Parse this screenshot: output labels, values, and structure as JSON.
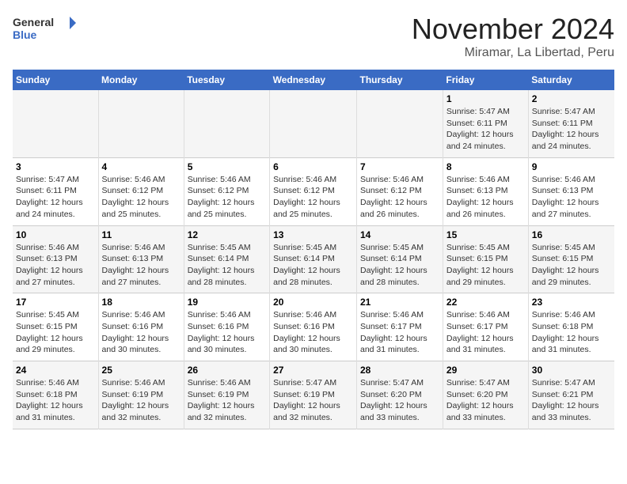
{
  "logo": {
    "line1": "General",
    "line2": "Blue"
  },
  "title": "November 2024",
  "subtitle": "Miramar, La Libertad, Peru",
  "days_header": [
    "Sunday",
    "Monday",
    "Tuesday",
    "Wednesday",
    "Thursday",
    "Friday",
    "Saturday"
  ],
  "weeks": [
    [
      {
        "day": "",
        "info": ""
      },
      {
        "day": "",
        "info": ""
      },
      {
        "day": "",
        "info": ""
      },
      {
        "day": "",
        "info": ""
      },
      {
        "day": "",
        "info": ""
      },
      {
        "day": "1",
        "info": "Sunrise: 5:47 AM\nSunset: 6:11 PM\nDaylight: 12 hours and 24 minutes."
      },
      {
        "day": "2",
        "info": "Sunrise: 5:47 AM\nSunset: 6:11 PM\nDaylight: 12 hours and 24 minutes."
      }
    ],
    [
      {
        "day": "3",
        "info": "Sunrise: 5:47 AM\nSunset: 6:11 PM\nDaylight: 12 hours and 24 minutes."
      },
      {
        "day": "4",
        "info": "Sunrise: 5:46 AM\nSunset: 6:12 PM\nDaylight: 12 hours and 25 minutes."
      },
      {
        "day": "5",
        "info": "Sunrise: 5:46 AM\nSunset: 6:12 PM\nDaylight: 12 hours and 25 minutes."
      },
      {
        "day": "6",
        "info": "Sunrise: 5:46 AM\nSunset: 6:12 PM\nDaylight: 12 hours and 25 minutes."
      },
      {
        "day": "7",
        "info": "Sunrise: 5:46 AM\nSunset: 6:12 PM\nDaylight: 12 hours and 26 minutes."
      },
      {
        "day": "8",
        "info": "Sunrise: 5:46 AM\nSunset: 6:13 PM\nDaylight: 12 hours and 26 minutes."
      },
      {
        "day": "9",
        "info": "Sunrise: 5:46 AM\nSunset: 6:13 PM\nDaylight: 12 hours and 27 minutes."
      }
    ],
    [
      {
        "day": "10",
        "info": "Sunrise: 5:46 AM\nSunset: 6:13 PM\nDaylight: 12 hours and 27 minutes."
      },
      {
        "day": "11",
        "info": "Sunrise: 5:46 AM\nSunset: 6:13 PM\nDaylight: 12 hours and 27 minutes."
      },
      {
        "day": "12",
        "info": "Sunrise: 5:45 AM\nSunset: 6:14 PM\nDaylight: 12 hours and 28 minutes."
      },
      {
        "day": "13",
        "info": "Sunrise: 5:45 AM\nSunset: 6:14 PM\nDaylight: 12 hours and 28 minutes."
      },
      {
        "day": "14",
        "info": "Sunrise: 5:45 AM\nSunset: 6:14 PM\nDaylight: 12 hours and 28 minutes."
      },
      {
        "day": "15",
        "info": "Sunrise: 5:45 AM\nSunset: 6:15 PM\nDaylight: 12 hours and 29 minutes."
      },
      {
        "day": "16",
        "info": "Sunrise: 5:45 AM\nSunset: 6:15 PM\nDaylight: 12 hours and 29 minutes."
      }
    ],
    [
      {
        "day": "17",
        "info": "Sunrise: 5:45 AM\nSunset: 6:15 PM\nDaylight: 12 hours and 29 minutes."
      },
      {
        "day": "18",
        "info": "Sunrise: 5:46 AM\nSunset: 6:16 PM\nDaylight: 12 hours and 30 minutes."
      },
      {
        "day": "19",
        "info": "Sunrise: 5:46 AM\nSunset: 6:16 PM\nDaylight: 12 hours and 30 minutes."
      },
      {
        "day": "20",
        "info": "Sunrise: 5:46 AM\nSunset: 6:16 PM\nDaylight: 12 hours and 30 minutes."
      },
      {
        "day": "21",
        "info": "Sunrise: 5:46 AM\nSunset: 6:17 PM\nDaylight: 12 hours and 31 minutes."
      },
      {
        "day": "22",
        "info": "Sunrise: 5:46 AM\nSunset: 6:17 PM\nDaylight: 12 hours and 31 minutes."
      },
      {
        "day": "23",
        "info": "Sunrise: 5:46 AM\nSunset: 6:18 PM\nDaylight: 12 hours and 31 minutes."
      }
    ],
    [
      {
        "day": "24",
        "info": "Sunrise: 5:46 AM\nSunset: 6:18 PM\nDaylight: 12 hours and 31 minutes."
      },
      {
        "day": "25",
        "info": "Sunrise: 5:46 AM\nSunset: 6:19 PM\nDaylight: 12 hours and 32 minutes."
      },
      {
        "day": "26",
        "info": "Sunrise: 5:46 AM\nSunset: 6:19 PM\nDaylight: 12 hours and 32 minutes."
      },
      {
        "day": "27",
        "info": "Sunrise: 5:47 AM\nSunset: 6:19 PM\nDaylight: 12 hours and 32 minutes."
      },
      {
        "day": "28",
        "info": "Sunrise: 5:47 AM\nSunset: 6:20 PM\nDaylight: 12 hours and 33 minutes."
      },
      {
        "day": "29",
        "info": "Sunrise: 5:47 AM\nSunset: 6:20 PM\nDaylight: 12 hours and 33 minutes."
      },
      {
        "day": "30",
        "info": "Sunrise: 5:47 AM\nSunset: 6:21 PM\nDaylight: 12 hours and 33 minutes."
      }
    ]
  ]
}
